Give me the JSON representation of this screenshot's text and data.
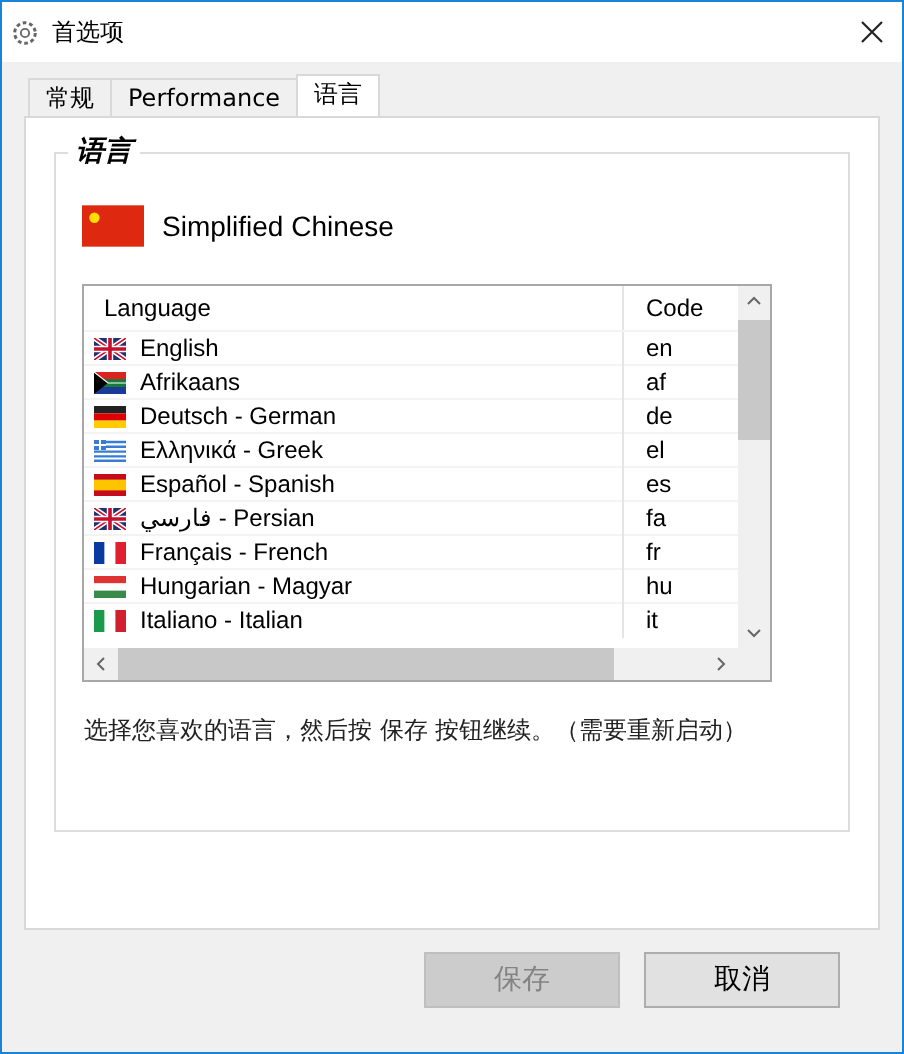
{
  "window": {
    "title": "首选项"
  },
  "tabs": [
    {
      "label": "常规",
      "selected": false
    },
    {
      "label": "Performance",
      "selected": false
    },
    {
      "label": "语言",
      "selected": true
    }
  ],
  "group": {
    "title": "语言",
    "current": {
      "kind": "cn",
      "name": "Simplified Chinese"
    },
    "table": {
      "columns": [
        "Language",
        "Code"
      ],
      "rows": [
        {
          "kind": "uk",
          "language": "English",
          "code": "en"
        },
        {
          "kind": "za",
          "language": "Afrikaans",
          "code": "af"
        },
        {
          "kind": "de",
          "language": "Deutsch - German",
          "code": "de"
        },
        {
          "kind": "gr",
          "language": "Ελληνικά - Greek",
          "code": "el"
        },
        {
          "kind": "es",
          "language": "Español - Spanish",
          "code": "es"
        },
        {
          "kind": "uk",
          "language": "فارسي - Persian",
          "code": "fa"
        },
        {
          "kind": "fr",
          "language": "Français - French",
          "code": "fr"
        },
        {
          "kind": "hu",
          "language": "Hungarian - Magyar",
          "code": "hu"
        },
        {
          "kind": "it",
          "language": "Italiano - Italian",
          "code": "it"
        }
      ]
    },
    "hint": "选择您喜欢的语言，然后按 保存 按钮继续。（需要重新启动）"
  },
  "buttons": [
    {
      "label": "保存",
      "disabled": true
    },
    {
      "label": "取消",
      "disabled": false
    }
  ]
}
